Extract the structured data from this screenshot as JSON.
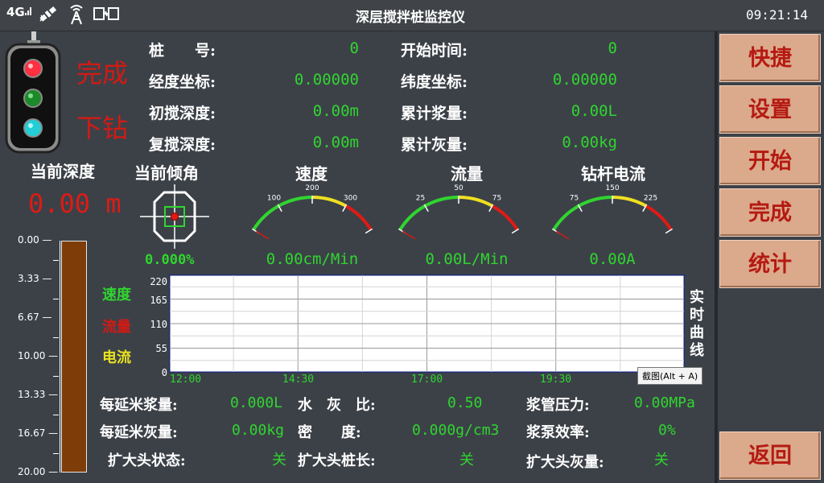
{
  "header": {
    "title": "深层搅拌桩监控仪",
    "clock": "09:21:14",
    "network_label": "4G"
  },
  "icons": [
    "signal-4g-icon",
    "satellite-icon",
    "antenna-icon",
    "network-link-icon"
  ],
  "status": {
    "line1": "完成",
    "line2": "下钻"
  },
  "info": {
    "pile_no_label": "桩　　号:",
    "pile_no": "0",
    "start_time_label": "开始时间:",
    "start_time": "0",
    "longitude_label": "经度坐标:",
    "longitude": "0.00000",
    "latitude_label": "纬度坐标:",
    "latitude": "0.00000",
    "first_depth_label": "初搅深度:",
    "first_depth": "0.00m",
    "total_slurry_label": "累计浆量:",
    "total_slurry": "0.00L",
    "re_depth_label": "复搅深度:",
    "re_depth": "0.00m",
    "total_ash_label": "累计灰量:",
    "total_ash": "0.00kg"
  },
  "depth": {
    "label": "当前深度",
    "value": "0.00 m",
    "scale": [
      "0.00",
      "3.33",
      "6.67",
      "10.00",
      "13.33",
      "16.67",
      "20.00"
    ],
    "fill_fraction": 1.0,
    "bar_color": "#7e3d08"
  },
  "tilt": {
    "label": "当前倾角",
    "value": "0.000%"
  },
  "gauges": [
    {
      "name": "speed",
      "title": "速度",
      "value_text": "0.00cm/Min",
      "value": 0,
      "min": 0,
      "max": 400,
      "ticks": [
        "0",
        "100",
        "200",
        "300",
        "400"
      ]
    },
    {
      "name": "flow",
      "title": "流量",
      "value_text": "0.00L/Min",
      "value": 0,
      "min": 0,
      "max": 100,
      "ticks": [
        "0",
        "25",
        "50",
        "75",
        "100"
      ]
    },
    {
      "name": "current",
      "title": "钻杆电流",
      "value_text": "0.00A",
      "value": 0,
      "min": 0,
      "max": 300,
      "ticks": [
        "0",
        "75",
        "150",
        "225",
        "300"
      ]
    }
  ],
  "chart": {
    "title": "实时曲线",
    "legend": [
      {
        "label": "速度",
        "color": "#30d52f"
      },
      {
        "label": "流量",
        "color": "#d31a14"
      },
      {
        "label": "电流",
        "color": "#e8e020"
      }
    ],
    "y_ticks": [
      "220",
      "165",
      "110",
      "55",
      "0"
    ],
    "x_ticks": [
      "12:00",
      "14:30",
      "17:00",
      "19:30"
    ],
    "tooltip": "截图(Alt + A)"
  },
  "chart_data": {
    "type": "line",
    "title": "实时曲线",
    "xlabel": "",
    "ylabel": "",
    "ylim": [
      0,
      220
    ],
    "x_ticks": [
      "12:00",
      "14:30",
      "17:00",
      "19:30"
    ],
    "grid": true,
    "series": [
      {
        "name": "速度",
        "values": []
      },
      {
        "name": "流量",
        "values": []
      },
      {
        "name": "电流",
        "values": []
      }
    ]
  },
  "bottom": {
    "slurry_per_m_label": "每延米浆量:",
    "slurry_per_m": "0.000L",
    "wc_ratio_label": "水　灰　比:",
    "wc_ratio": "0.50",
    "pipe_pressure_label": "浆管压力:",
    "pipe_pressure": "0.00MPa",
    "ash_per_m_label": "每延米灰量:",
    "ash_per_m": "0.00kg",
    "density_label": "密　　度:",
    "density": "0.000g/cm3",
    "pump_eff_label": "浆泵效率:",
    "pump_eff": "0%",
    "head_state_label": "扩大头状态:",
    "head_state": "关",
    "head_len_label": "扩大头桩长:",
    "head_len": "关",
    "head_ash_label": "扩大头灰量:",
    "head_ash": "关"
  },
  "buttons": {
    "shortcut": "快捷",
    "settings": "设置",
    "start": "开始",
    "finish": "完成",
    "stats": "统计",
    "back": "返回"
  },
  "colors": {
    "panel": "#3c4148",
    "value_green": "#30d52f",
    "accent_red": "#d31a14",
    "button_bg": "#dba98b"
  }
}
